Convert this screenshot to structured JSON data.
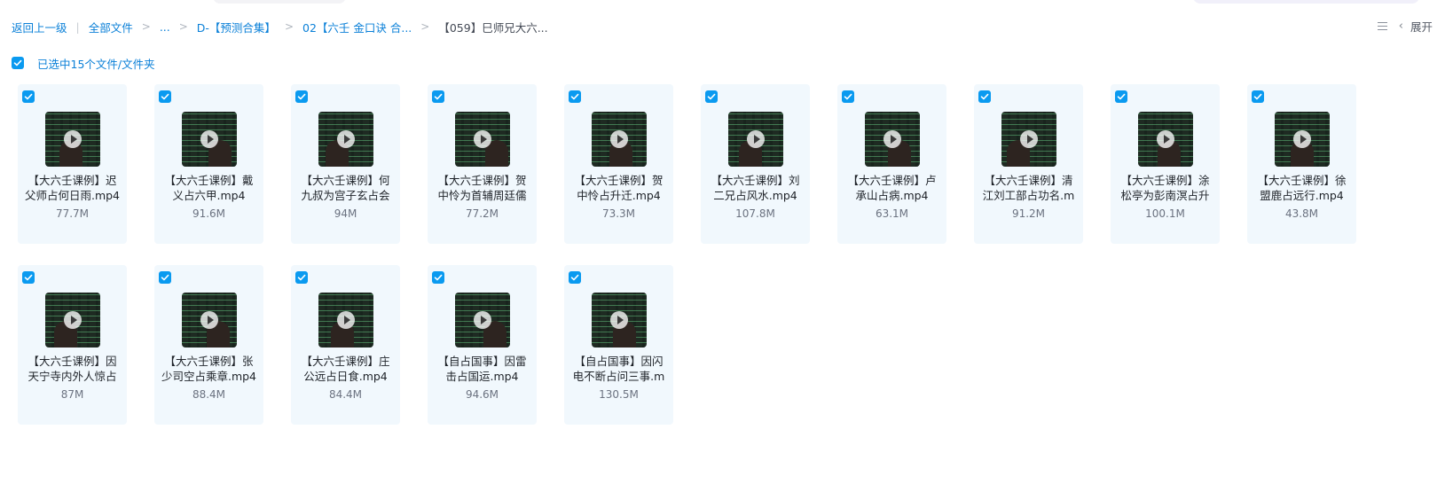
{
  "breadcrumb": {
    "back": "返回上一级",
    "divider": "|",
    "all_files": "全部文件",
    "ellipsis": "...",
    "level1": "D-【预测合集】",
    "level2": "02【六壬 金口诀 合...",
    "current": "【059】巳师兄大六...",
    "sep": ">"
  },
  "toolbar": {
    "expand_label": "展开",
    "list_icon": "list-view-icon",
    "chevron_icon": "chevron-left-icon"
  },
  "selection": {
    "label": "已选中15个文件/文件夹"
  },
  "colors": {
    "accent": "#0a9af0",
    "link": "#0b80d8",
    "card_bg": "#f1f8fd"
  },
  "files": [
    {
      "name": "【大六壬课例】迟父师占何日雨.mp4",
      "size": "77.7M"
    },
    {
      "name": "【大六壬课例】戴义占六甲.mp4",
      "size": "91.6M"
    },
    {
      "name": "【大六壬课例】何九叔为宫子玄占会",
      "size": "94M"
    },
    {
      "name": "【大六壬课例】贺中怜为首辅周廷儒",
      "size": "77.2M"
    },
    {
      "name": "【大六壬课例】贺中怜占升迁.mp4",
      "size": "73.3M"
    },
    {
      "name": "【大六壬课例】刘二兄占风水.mp4",
      "size": "107.8M"
    },
    {
      "name": "【大六壬课例】卢承山占病.mp4",
      "size": "63.1M"
    },
    {
      "name": "【大六壬课例】清江刘工部占功名.m",
      "size": "91.2M"
    },
    {
      "name": "【大六壬课例】涂松亭为彭南溟占升",
      "size": "100.1M"
    },
    {
      "name": "【大六壬课例】徐盟鹿占远行.mp4",
      "size": "43.8M"
    },
    {
      "name": "【大六壬课例】因天宁寺内外人惊占",
      "size": "87M"
    },
    {
      "name": "【大六壬课例】张少司空占乘章.mp4",
      "size": "88.4M"
    },
    {
      "name": "【大六壬课例】庄公远占日食.mp4",
      "size": "84.4M"
    },
    {
      "name": "【自占国事】因雷击占国运.mp4",
      "size": "94.6M"
    },
    {
      "name": "【自占国事】因闪电不断占问三事.m",
      "size": "130.5M"
    }
  ]
}
